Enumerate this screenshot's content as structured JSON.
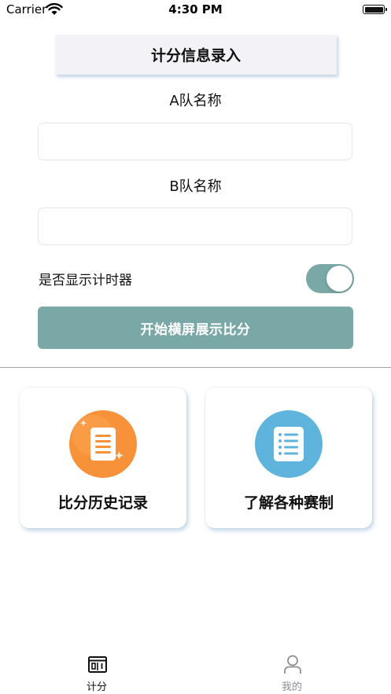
{
  "status_bar": {
    "carrier": "Carrier",
    "time": "4:30 PM"
  },
  "header": {
    "title": "计分信息录入"
  },
  "form": {
    "team_a_label": "A队名称",
    "team_a_value": "",
    "team_b_label": "B队名称",
    "team_b_value": "",
    "timer_label": "是否显示计时器",
    "timer_enabled": true,
    "start_button_label": "开始横屏展示比分"
  },
  "cards": [
    {
      "label": "比分历史记录",
      "icon": "document-icon",
      "color": "#f7923a"
    },
    {
      "label": "了解各种赛制",
      "icon": "list-icon",
      "color": "#5fb4dd"
    }
  ],
  "tab_bar": {
    "items": [
      {
        "label": "计分",
        "icon": "scoreboard-icon",
        "active": true
      },
      {
        "label": "我的",
        "icon": "person-icon",
        "active": false
      }
    ]
  },
  "colors": {
    "accent": "#7aa8a6",
    "active_tab": "#111111",
    "inactive_tab": "#8e8e93"
  }
}
